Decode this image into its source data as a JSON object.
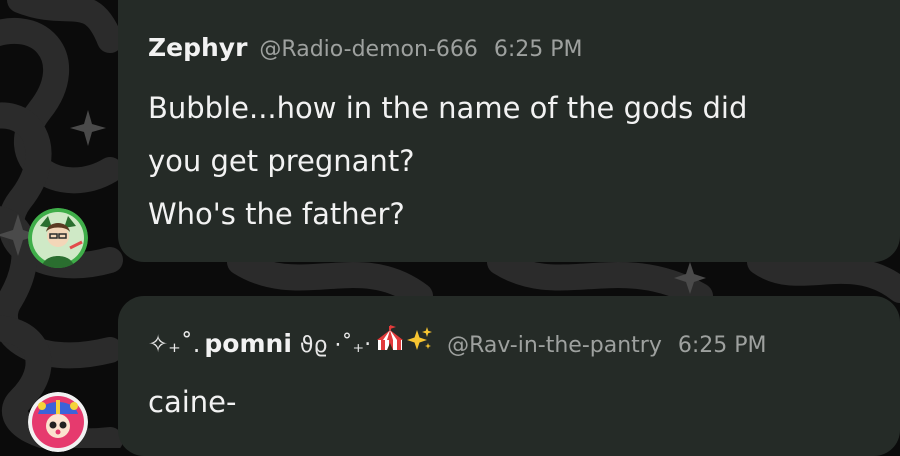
{
  "colors": {
    "background": "#0b0b0b",
    "bubble": "#252b27",
    "text_primary": "#f2f2f2",
    "text_secondary": "#9ea19f"
  },
  "messages": [
    {
      "author": "Zephyr",
      "handle": "@Radio-demon-666",
      "time": "6:25 PM",
      "lines": [
        "Bubble...how in the name of the gods did",
        "you get pregnant?",
        "Who's the father?"
      ],
      "avatar_icon": "green-character-avatar"
    },
    {
      "author_prefix": "✧₊˚.",
      "author": "pomni",
      "author_suffix": "ϑϱ ⋅˚₊‧",
      "author_icons": [
        "circus-tent-icon",
        "sparkles-icon"
      ],
      "handle": "@Rav-in-the-pantry",
      "time": "6:25 PM",
      "lines": [
        "caine-"
      ],
      "avatar_icon": "clown-character-avatar"
    }
  ]
}
